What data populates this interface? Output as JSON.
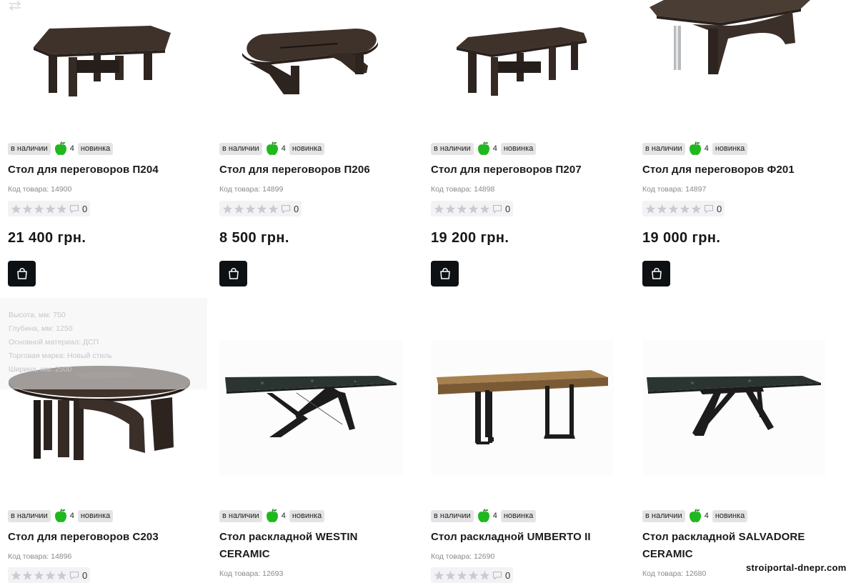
{
  "products": [
    {
      "stock": "в наличии",
      "apple_count": "4",
      "badge_new": "новинка",
      "title": "Стол для переговоров П204",
      "code": "Код товара: 14900",
      "rating_count": "0",
      "price": "21 400 грн."
    },
    {
      "stock": "в наличии",
      "apple_count": "4",
      "badge_new": "новинка",
      "title": "Стол для переговоров П206",
      "code": "Код товара: 14899",
      "rating_count": "0",
      "price": "8 500 грн."
    },
    {
      "stock": "в наличии",
      "apple_count": "4",
      "badge_new": "новинка",
      "title": "Стол для переговоров П207",
      "code": "Код товара: 14898",
      "rating_count": "0",
      "price": "19 200 грн."
    },
    {
      "stock": "в наличии",
      "apple_count": "4",
      "badge_new": "новинка",
      "title": "Стол для переговоров Ф201",
      "code": "Код товара: 14897",
      "rating_count": "0",
      "price": "19 000 грн."
    },
    {
      "stock": "в наличии",
      "apple_count": "4",
      "badge_new": "новинка",
      "title": "Стол для переговоров С203",
      "code": "Код товара: 14896",
      "rating_count": "0"
    },
    {
      "stock": "в наличии",
      "apple_count": "4",
      "badge_new": "новинка",
      "title_line1": "Стол раскладной WESTIN",
      "title_line2": "CERAMIC",
      "code": "Код товара: 12693"
    },
    {
      "stock": "в наличии",
      "apple_count": "4",
      "badge_new": "новинка",
      "title": "Стол раскладной UMBERTO II",
      "code": "Код товара: 12690",
      "rating_count": "0"
    },
    {
      "stock": "в наличии",
      "apple_count": "4",
      "badge_new": "новинка",
      "title_line1": "Стол раскладной SALVADORE",
      "title_line2": "CERAMIC",
      "code": "Код товара: 12680"
    }
  ],
  "specs_tooltip": [
    "Высота, мм: 750",
    "Глубина, мм: 1250",
    "Основной материал: ДСП",
    "Торговая марка: Новый стиль",
    "Ширина, мм: 2500"
  ],
  "watermark": "stroiportal-dnepr.com",
  "icons": {
    "compare": "compare-arrows-icon",
    "cart": "shopping-bag-icon",
    "apple": "green-apple-icon",
    "star": "star-icon",
    "comment": "comment-icon"
  },
  "colors": {
    "cart_button": "#0e1113",
    "badge_bg": "#e4e4e6",
    "apple_green": "#1fb81f",
    "star_empty": "#c9cad3",
    "wood_dark": "#3e322b",
    "ceramic_top": "#2b3430",
    "oak_top": "#a7804f"
  }
}
